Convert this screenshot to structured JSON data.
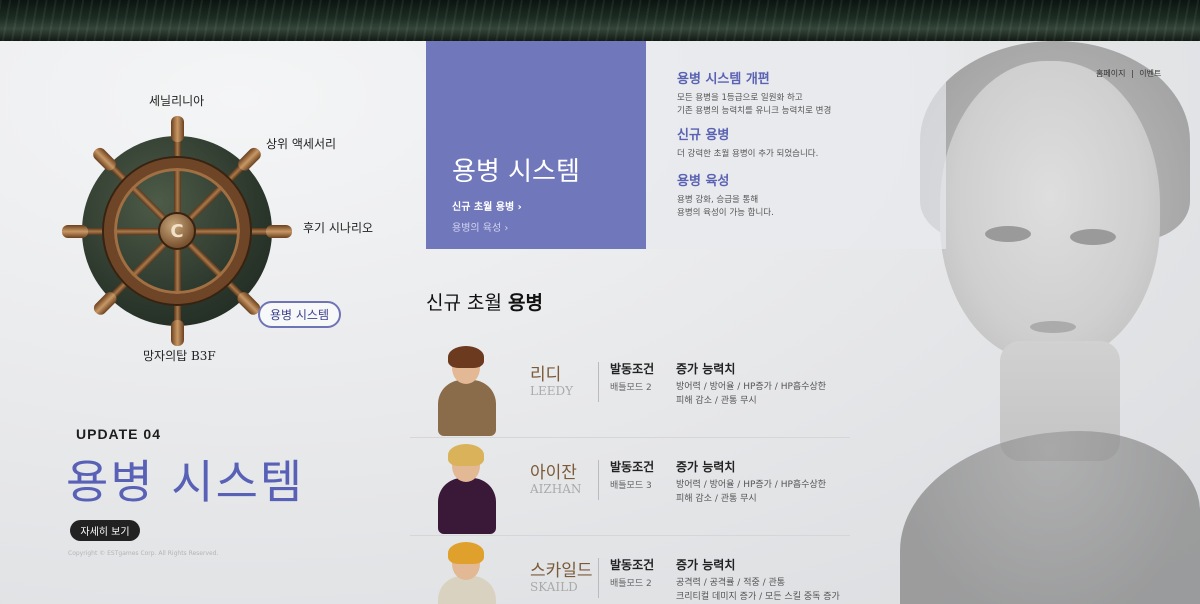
{
  "nav": {
    "links": [
      "홈페이지",
      "|",
      "이벤트"
    ]
  },
  "helm": {
    "items": [
      {
        "label": "세닐리니아"
      },
      {
        "label": "상위 액세서리"
      },
      {
        "label": "후기 시나리오"
      },
      {
        "label": "용병 시스템",
        "active": true
      },
      {
        "label": "망자의탑 B3F"
      }
    ],
    "hub_label": "C"
  },
  "update": {
    "tag": "UPDATE 04",
    "title": "용병 시스템",
    "detail_button": "자세히 보기",
    "copyright": "Copyright © ESTgames Corp. All Rights Reserved."
  },
  "system_box": {
    "title": "용병 시스템",
    "links": [
      "신규 초월 용병  ›",
      "용병의 육성  ›"
    ]
  },
  "features": [
    {
      "title": "용병 시스템 개편",
      "lines": [
        "모든 용병을 1등급으로 일원화 하고",
        "기존 용병의 능력치를 유니크 능력치로 변경"
      ]
    },
    {
      "title": "신규 용병",
      "lines": [
        "더 강력한 초월 용병이 추가 되었습니다."
      ]
    },
    {
      "title": "용병 육성",
      "lines": [
        "용병 강화, 승급을 통해",
        "용병의 육성이 가능 합니다."
      ]
    }
  ],
  "section": {
    "title_prefix": "신규 초월 ",
    "title_bold": "용병"
  },
  "mercenaries": [
    {
      "name": "리디",
      "en": "LEEDY",
      "cond_label": "발동조건",
      "cond": "배틀모드 2",
      "abil_label": "증가 능력치",
      "abil": [
        "방어력 / 방어율 / HP증가 / HP흡수상한",
        "피해 감소 / 관통 무시"
      ],
      "hair_color": "#6b3a1f",
      "body_color": "#8a6b4a"
    },
    {
      "name": "아이잔",
      "en": "AIZHAN",
      "cond_label": "발동조건",
      "cond": "배틀모드 3",
      "abil_label": "증가 능력치",
      "abil": [
        "방어력 / 방어율 / HP증가 / HP흡수상한",
        "피해 감소 / 관통 무시"
      ],
      "hair_color": "#d9b25a",
      "body_color": "#3a1838"
    },
    {
      "name": "스카일드",
      "en": "SKAILD",
      "cond_label": "발동조건",
      "cond": "배틀모드 2",
      "abil_label": "증가 능력치",
      "abil": [
        "공격력 / 공격률 / 적중 / 관통",
        "크리티컬 데미지 증가 / 모든 스킬 중독 증가"
      ],
      "hair_color": "#e0a12c",
      "body_color": "#d9d2c0"
    }
  ],
  "colors": {
    "accent": "#7077bb",
    "title": "#5861b6",
    "merc_name": "#7a5a38"
  }
}
